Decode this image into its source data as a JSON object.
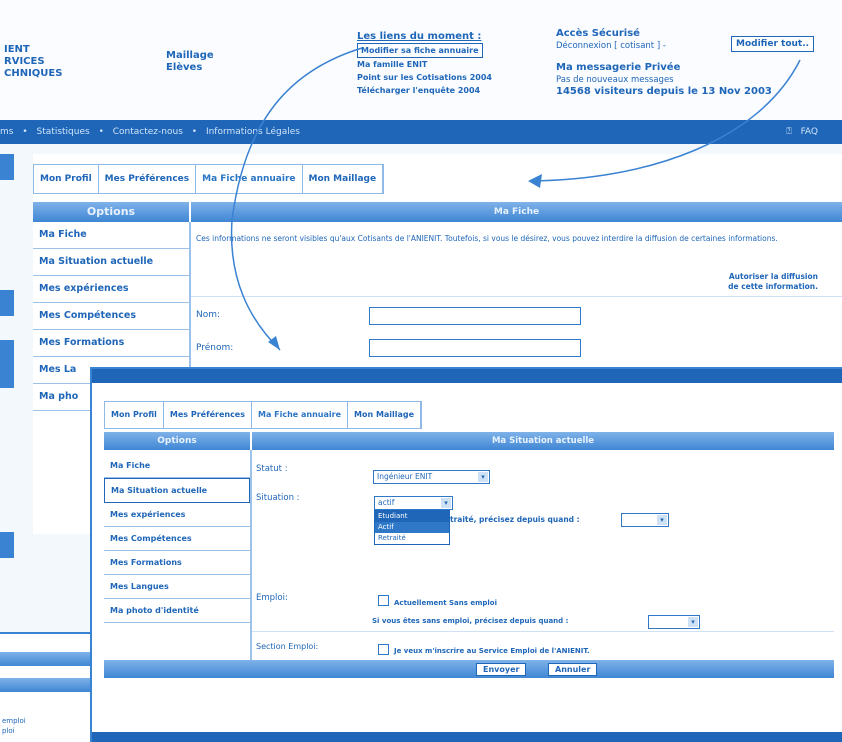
{
  "header": {
    "org_lines": [
      "IENT",
      "RVICES",
      "CHNIQUES"
    ],
    "maillage_lines": [
      "Maillage",
      "Elèves"
    ],
    "links_title": "Les liens du moment :",
    "links": [
      "Modifier sa fiche annuaire",
      "Ma famille ENIT",
      "Point sur les Cotisations 2004",
      "Télécharger l'enquête 2004"
    ],
    "acces_title": "Accès Sécurisé",
    "acces_line": "Déconnexion [ cotisant ] -",
    "modify_all": "Modifier tout..",
    "messagerie_title": "Ma messagerie Privée",
    "messagerie_status": "Pas de nouveaux messages",
    "visitors": "14568 visiteurs depuis le 13 Nov 2003"
  },
  "navbar": {
    "items": [
      "ms",
      "Statistiques",
      "Contactez-nous",
      "Informations Légales"
    ],
    "faq": "FAQ"
  },
  "screen1": {
    "tabs": [
      "Mon Profil",
      "Mes Préférences",
      "Ma Fiche annuaire",
      "Mon Maillage"
    ],
    "options_title": "Options",
    "options": [
      "Ma Fiche",
      "Ma Situation actuelle",
      "Mes expériences",
      "Mes Compétences",
      "Mes Formations",
      "Mes La",
      "Ma pho"
    ],
    "main_title": "Ma Fiche",
    "info_text": "Ces informations ne seront visibles qu'aux Cotisants de l'ANIENIT. Toutefois, si vous le désirez, vous pouvez interdire la diffusion de certaines informations.",
    "autoriser_lines": [
      "Autoriser la diffusion",
      "de cette information."
    ],
    "fields": [
      "Nom:",
      "Prénom:"
    ]
  },
  "screen2": {
    "tabs": [
      "Mon Profil",
      "Mes Préférences",
      "Ma Fiche annuaire",
      "Mon Maillage"
    ],
    "options_title": "Options",
    "options": [
      "Ma Fiche",
      "Ma Situation actuelle",
      "Mes expériences",
      "Mes Compétences",
      "Mes Formations",
      "Mes Langues",
      "Ma photo d'identité"
    ],
    "main_title": "Ma Situation actuelle",
    "statut_label": "Statut :",
    "statut_value": "Ingénieur ENIT",
    "situation_label": "Situation :",
    "situation_value": "actif",
    "situation_options": [
      "Etudiant",
      "Actif",
      "Retraité"
    ],
    "retraite_text": "traité, précisez depuis quand :",
    "emploi_label": "Emploi:",
    "emploi_checkbox": "Actuellement Sans emploi",
    "emploi_note": "Si vous êtes sans emploi, précisez depuis quand :",
    "section_label": "Section Emploi:",
    "section_checkbox": "Je veux m'inscrire au Service Emploi de l'ANIENIT.",
    "submit": "Envoyer",
    "cancel": "Annuler"
  },
  "screen3": {
    "lines": [
      "emploi",
      "ploi"
    ]
  },
  "colors": {
    "primary": "#1f66b8",
    "accent": "#3a82d2",
    "background": "#f3f8fd"
  }
}
